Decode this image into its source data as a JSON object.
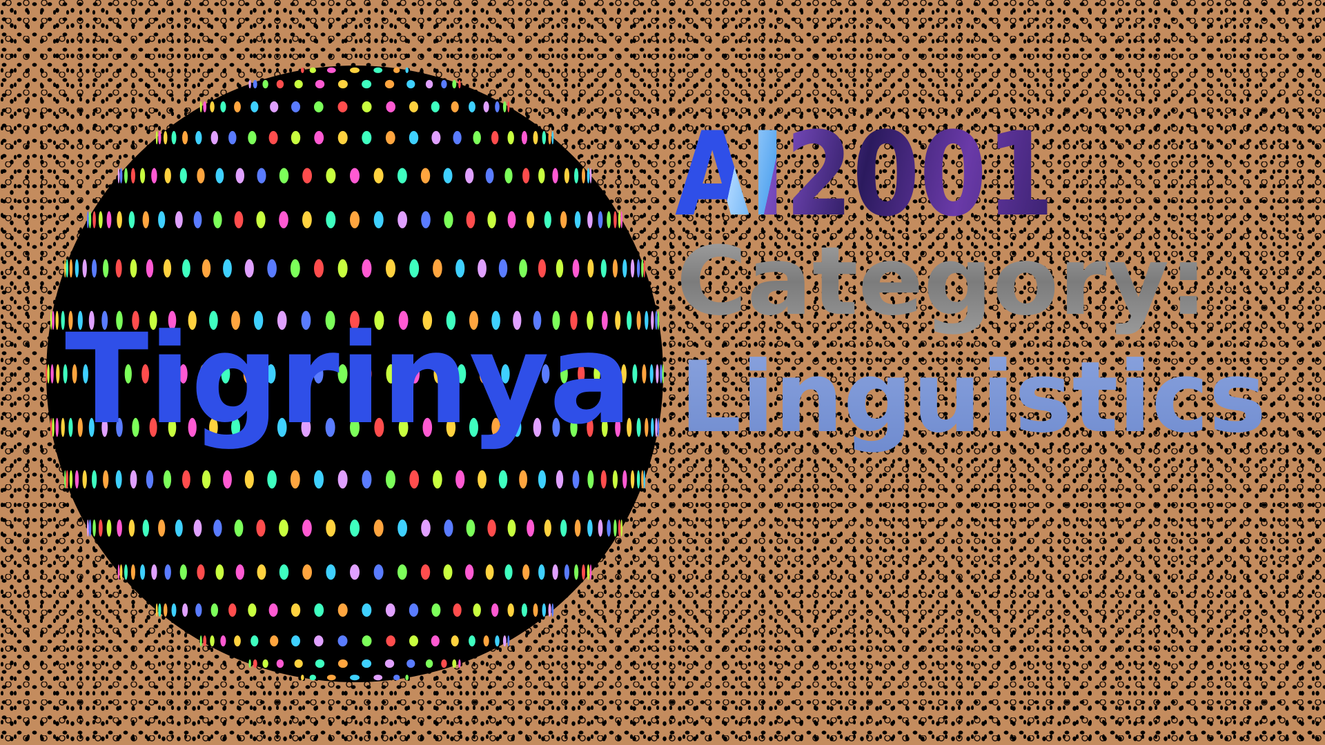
{
  "sphere_label": "Tigrinya",
  "title_line1": "AI2001",
  "title_line2": "Category:",
  "title_line3": "Linguistics",
  "colors": {
    "background": "#c48c5e",
    "sphere": "#000000",
    "tigrinya_text": "#2f4fe8",
    "ai_text": "#2f4fe8",
    "year_text": "#5a2f8c",
    "category_text": "#8a8a8a",
    "linguistics_text": "#7b95d6"
  }
}
